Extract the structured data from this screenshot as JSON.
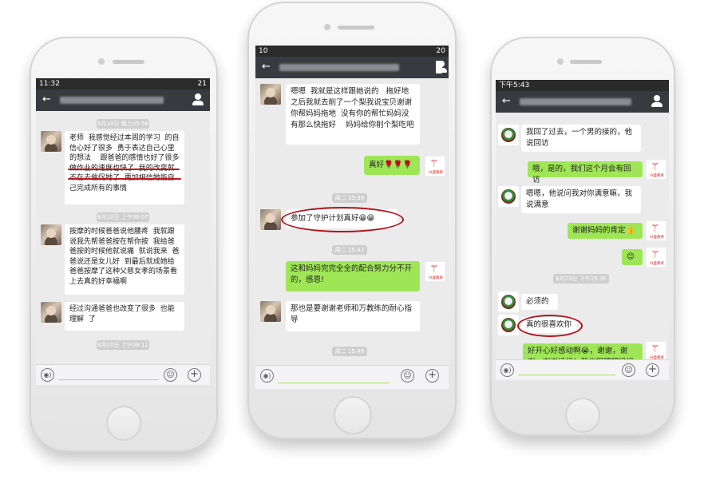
{
  "phone1": {
    "status_time": "11:32",
    "status_battery": "21",
    "back_icon": "back-arrow-icon",
    "timestamps": [
      "8月10日 晚上05:58",
      "8月10日 上午06:07",
      "8月10日 上午08:11"
    ],
    "messages": [
      "老师  我感觉经过本周的学习  的自信心好了很多  勇于表达自己心里的想法    跟爸爸的感情也好了很多   做作业的速度也快了  我的改变就不在去催促她了  更加相信她能自己完成所有的事情",
      "按摩的时候爸爸说他腰疼  我就跟  说我先帮爸爸按在帮你按  我给爸爸按的时候他就说痛  就说我来  爸爸说还是女儿好  到最后就成她给爸爸按摩了这种父慈女孝的场景看上去真的好幸福啊",
      "经过沟通爸爸也改变了很多  也能理解  了"
    ]
  },
  "phone2": {
    "status_time": "10",
    "status_battery": "20",
    "timestamps": [
      "周二 15:39",
      "周二 15:42",
      "周二 15:49"
    ],
    "messages": [
      {
        "side": "left",
        "text": "嗯嗯  我就是这样跟她说的   拖好地之后我就去削了一个梨我说宝贝谢谢你帮妈妈拖地  没有你的帮忙妈妈没有那么快拖好    妈妈给你削个梨吃吧"
      },
      {
        "side": "right",
        "text": "真好🌹🌹🌹"
      },
      {
        "side": "left",
        "text": "参加了守护计划真好😁😁"
      },
      {
        "side": "right",
        "text": "这和妈妈完完全全的配合努力分不开的，感恩!"
      },
      {
        "side": "left",
        "text": "那也是要谢谢老师和万教练的耐心指导"
      }
    ]
  },
  "phone3": {
    "status_time": "下午5:43",
    "timestamps": [
      "8月23日 下午15:30"
    ],
    "messages": [
      {
        "side": "left",
        "text": "我回了过去，一个男的接的，他说回访"
      },
      {
        "side": "right",
        "text": "哦，是的，我们这个月会有回访"
      },
      {
        "side": "left",
        "text": "嗯嗯，他说问我对你满意嘛，我说满意"
      },
      {
        "side": "right",
        "text": "谢谢妈妈的肯定👍"
      },
      {
        "side": "right",
        "text": "😊"
      },
      {
        "side": "left",
        "text": "必须的"
      },
      {
        "side": "left",
        "text": "真的很喜欢你"
      },
      {
        "side": "right",
        "text": "好开心好感动啊😭，谢谢，谢谢，谢谢妈妈！我也很理解妈妈"
      }
    ]
  },
  "logo": {
    "mark": "⚚",
    "text": "兴盛教育"
  },
  "icons": {
    "voice": "voice-icon",
    "emoji": "emoji-icon",
    "plus": "plus-icon",
    "user": "user-icon",
    "back": "back-arrow-icon"
  },
  "input_glyphs": {
    "voice": "◉)",
    "emoji": "☺",
    "plus": "+",
    "back": "←"
  },
  "colors": {
    "nav": "#393a3f",
    "bubble_right": "#9fe657",
    "bubble_left": "#ffffff",
    "annotation": "#b3121a"
  }
}
